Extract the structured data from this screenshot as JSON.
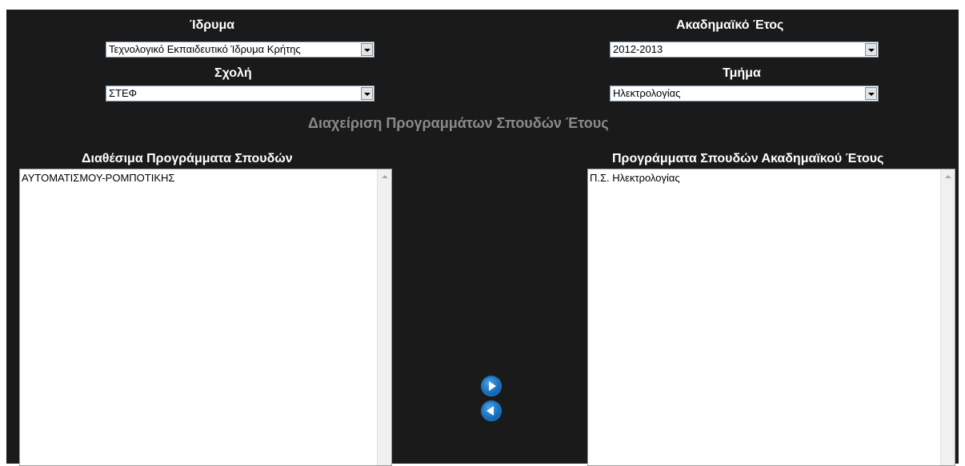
{
  "filters": {
    "institution": {
      "label": "Ίδρυμα",
      "value": "Τεχνολογικό Εκπαιδευτικό Ίδρυμα Κρήτης"
    },
    "academic_year": {
      "label": "Ακαδημαϊκό Έτος",
      "value": "2012-2013"
    },
    "school": {
      "label": "Σχολή",
      "value": "ΣΤΕΦ"
    },
    "department": {
      "label": "Τμήμα",
      "value": "Ηλεκτρολογίας"
    }
  },
  "heading": "Διαχείριση Προγραμμάτων Σπουδών Έτους",
  "available": {
    "title": "Διαθέσιμα Προγράμματα Σπουδών",
    "items": [
      "ΑΥΤΟΜΑΤΙΣΜΟΥ-ΡΟΜΠΟΤΙΚΗΣ"
    ]
  },
  "assigned": {
    "title": "Προγράμματα Σπουδών Ακαδημαϊκού Έτους",
    "items": [
      "Π.Σ. Ηλεκτρολογίας"
    ]
  },
  "actions": {
    "add_icon": "arrow-right-circle-icon",
    "remove_icon": "arrow-left-circle-icon"
  },
  "colors": {
    "panel_bg": "#1a1a1a",
    "heading": "#8a8a8a",
    "button": "#0b5fae"
  }
}
